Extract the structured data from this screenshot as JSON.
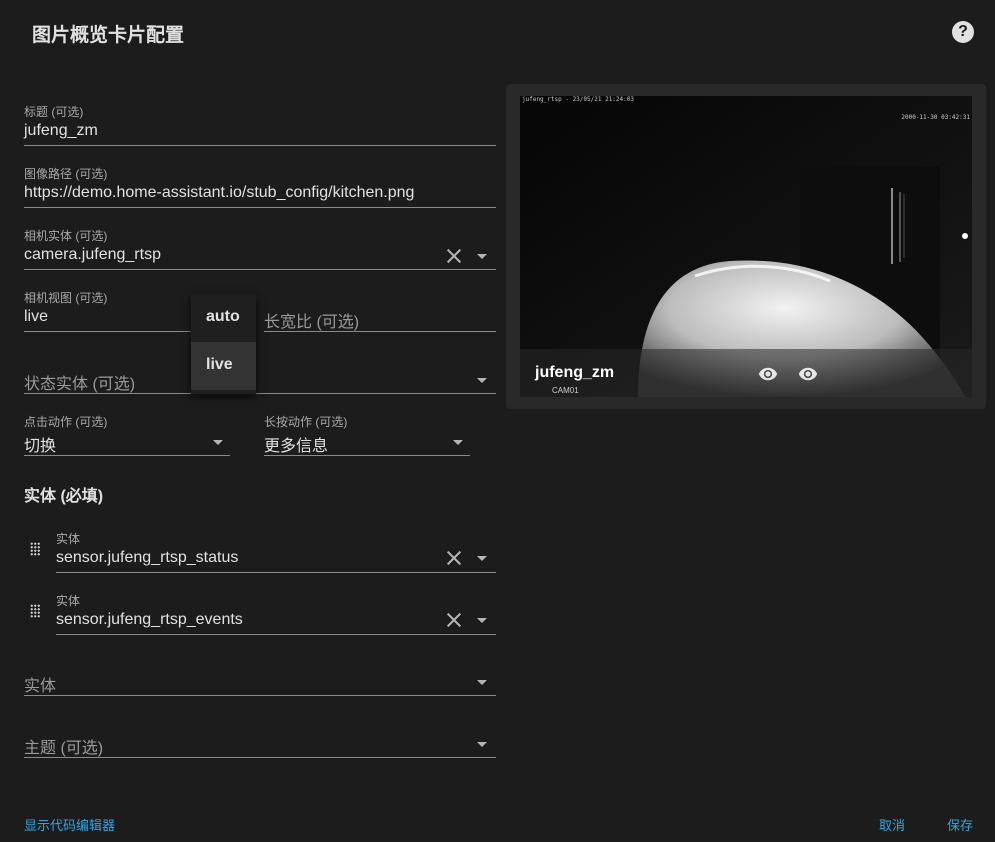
{
  "dialog": {
    "title": "图片概览卡片配置"
  },
  "form": {
    "title": {
      "label": "标题 (可选)",
      "value": "jufeng_zm"
    },
    "image_path": {
      "label": "图像路径 (可选)",
      "value": "https://demo.home-assistant.io/stub_config/kitchen.png"
    },
    "camera_entity": {
      "label": "相机实体 (可选)",
      "value": "camera.jufeng_rtsp"
    },
    "camera_view": {
      "label": "相机视图 (可选)",
      "value": "live"
    },
    "aspect_ratio": {
      "placeholder": "长宽比 (可选)"
    },
    "state_entity": {
      "placeholder": "状态实体 (可选)"
    },
    "tap_action": {
      "label": "点击动作 (可选)",
      "value": "切换"
    },
    "hold_action": {
      "label": "长按动作 (可选)",
      "value": "更多信息"
    }
  },
  "camera_view_menu": {
    "options": [
      "auto",
      "live"
    ],
    "selected": "live"
  },
  "entities_section": {
    "heading": "实体 (必填)",
    "items": [
      {
        "label": "实体",
        "value": "sensor.jufeng_rtsp_status"
      },
      {
        "label": "实体",
        "value": "sensor.jufeng_rtsp_events"
      }
    ],
    "add_placeholder": "实体"
  },
  "theme": {
    "placeholder": "主题 (可选)"
  },
  "preview": {
    "overlay_top": "jufeng_rtsp - 23/05/21 21:24:03",
    "overlay_time": "2000-11-30 03:42:31",
    "card_title": "jufeng_zm",
    "camera_label": "CAM01"
  },
  "footer": {
    "show_code_editor": "显示代码编辑器",
    "cancel": "取消",
    "save": "保存"
  },
  "colors": {
    "accent": "#2ea7e8",
    "background": "#1c1c1c",
    "card": "#292929"
  }
}
